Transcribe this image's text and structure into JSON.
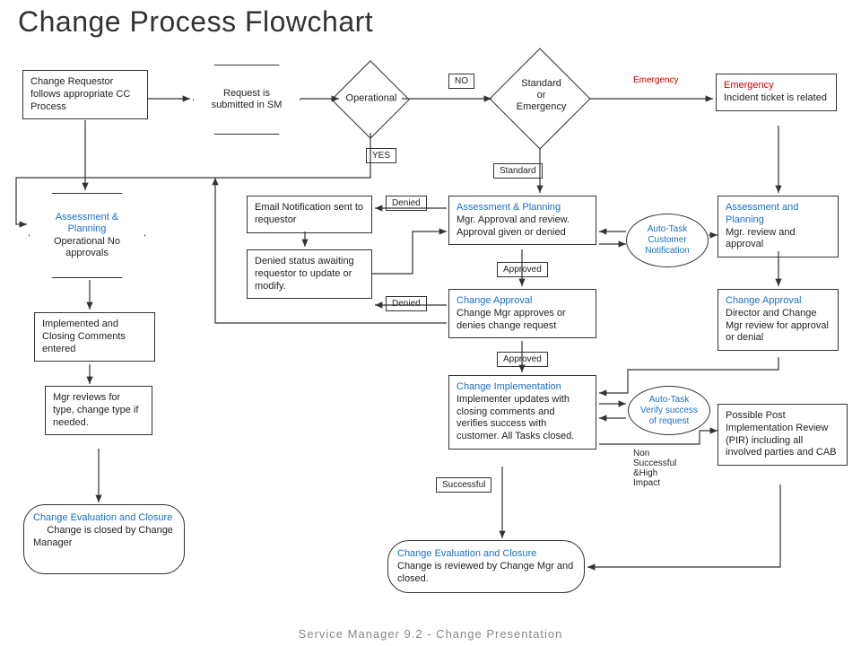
{
  "title": "Change Process Flowchart",
  "footer": "Service Manager 9.2 - Change Presentation",
  "nodes": {
    "requestor": "Change Requestor follows appropriate CC Process",
    "request_sm": "Request is submitted in SM",
    "operational_q": "Operational",
    "std_emerg_q_l1": "Standard",
    "std_emerg_q_l2": "or",
    "std_emerg_q_l3": "Emergency",
    "emerg_ticket_l1": "Emergency",
    "emerg_ticket_l2": "Incident ticket is related",
    "assess_op_t": "Assessment & Planning",
    "assess_op_b": "Operational No approvals",
    "email_notif": "Email Notification sent to requestor",
    "denied_status": "Denied status awaiting requestor to update or modify.",
    "assess_plan_t": "Assessment & Planning",
    "assess_plan_b": "Mgr. Approval and review. Approval given or denied",
    "assess_emerg_t": "Assessment and Planning",
    "assess_emerg_b": "Mgr. review and approval",
    "oval_cust": "Auto-Task Customer Notification",
    "change_appr_t": "Change Approval",
    "change_appr_b": "Change Mgr approves or denies change request",
    "change_appr_e_t": "Change Approval",
    "change_appr_e_b": "Director and Change Mgr review for approval or denial",
    "impl_close": "Implemented and Closing Comments entered",
    "mgr_reviews": "Mgr reviews for type, change type if needed.",
    "change_impl_t": "Change Implementation",
    "change_impl_b": "Implementer updates with closing comments and verifies success with customer. All Tasks closed.",
    "oval_verify": "Auto-Task Verify success of request",
    "pir": "Possible Post Implementation Review (PIR) including all involved parties and CAB",
    "eval_closure_l_t": "Change Evaluation and Closure",
    "eval_closure_l_b": "Change is closed by Change Manager",
    "eval_closure_c_t": "Change Evaluation and Closure",
    "eval_closure_c_b": "Change is reviewed by Change Mgr and closed."
  },
  "tags": {
    "no": "NO",
    "yes": "YES",
    "emergency": "Emergency",
    "standard": "Standard",
    "denied1": "Denied",
    "denied2": "Denied",
    "approved1": "Approved",
    "approved2": "Approved",
    "successful": "Successful",
    "non_success": "Non Successful &High Impact"
  }
}
